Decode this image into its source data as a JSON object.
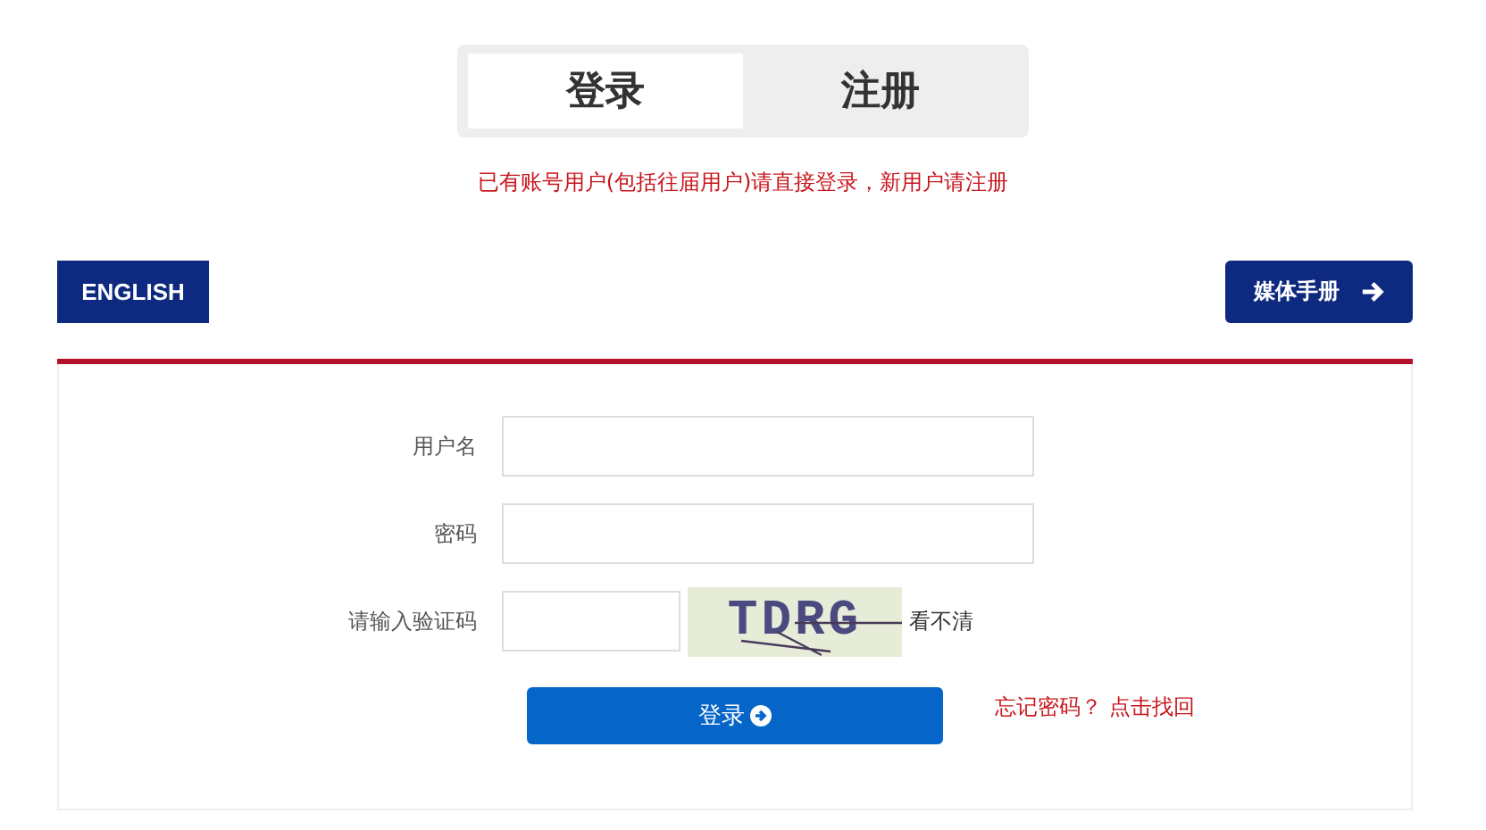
{
  "tabs": [
    {
      "label": "登录",
      "selected": true
    },
    {
      "label": "注册",
      "selected": false
    }
  ],
  "notice": "已有账号用户(包括往届用户)请直接登录，新用户请注册",
  "english_button": "ENGLISH",
  "media_button": "媒体手册",
  "form": {
    "fields": [
      {
        "label": "用户名",
        "kind": "text"
      },
      {
        "label": "密码",
        "kind": "password"
      },
      {
        "label": "请输入验证码",
        "kind": "captcha",
        "captcha": "TDRG",
        "refresh": "看不清"
      }
    ],
    "submit": "登录",
    "forgot": "忘记密码？ 点击找回"
  }
}
